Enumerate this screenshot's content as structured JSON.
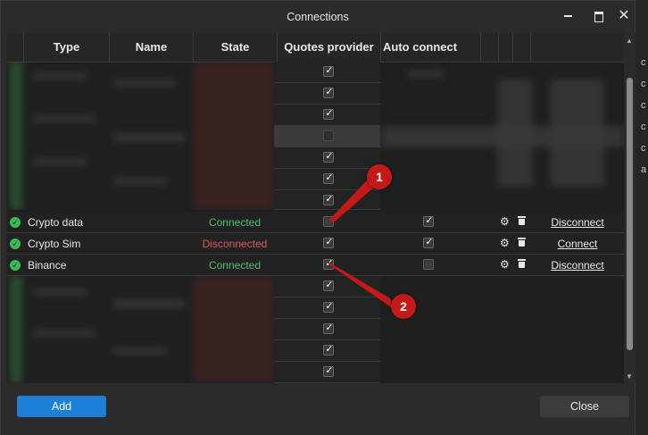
{
  "window": {
    "title": "Connections",
    "close_glyph": "✕"
  },
  "columns": {
    "type": "Type",
    "name": "Name",
    "state": "State",
    "quotes_provider": "Quotes provider",
    "auto_connect": "Auto connect"
  },
  "top_blurred_quotes": [
    true,
    true,
    true,
    false,
    true,
    true,
    true
  ],
  "connections": [
    {
      "name": "Crypto data",
      "state": "Connected",
      "state_kind": "good",
      "quotes_provider": false,
      "auto_connect": true,
      "action": "Disconnect"
    },
    {
      "name": "Crypto Sim",
      "state": "Disconnected",
      "state_kind": "bad",
      "quotes_provider": true,
      "auto_connect": true,
      "action": "Connect"
    },
    {
      "name": "Binance",
      "state": "Connected",
      "state_kind": "good",
      "quotes_provider": true,
      "auto_connect": false,
      "action": "Disconnect"
    }
  ],
  "bottom_blurred_quotes": [
    true,
    true,
    true,
    true,
    true
  ],
  "footer": {
    "add_label": "Add",
    "close_label": "Close"
  },
  "annotations": [
    "1",
    "2"
  ],
  "background_letters": [
    "c",
    "c",
    "c",
    "c",
    "c",
    "a"
  ],
  "colors": {
    "accent": "#1e7fd6",
    "connected": "#4cc26a",
    "disconnected": "#e05a5a",
    "callout": "#c41919"
  }
}
